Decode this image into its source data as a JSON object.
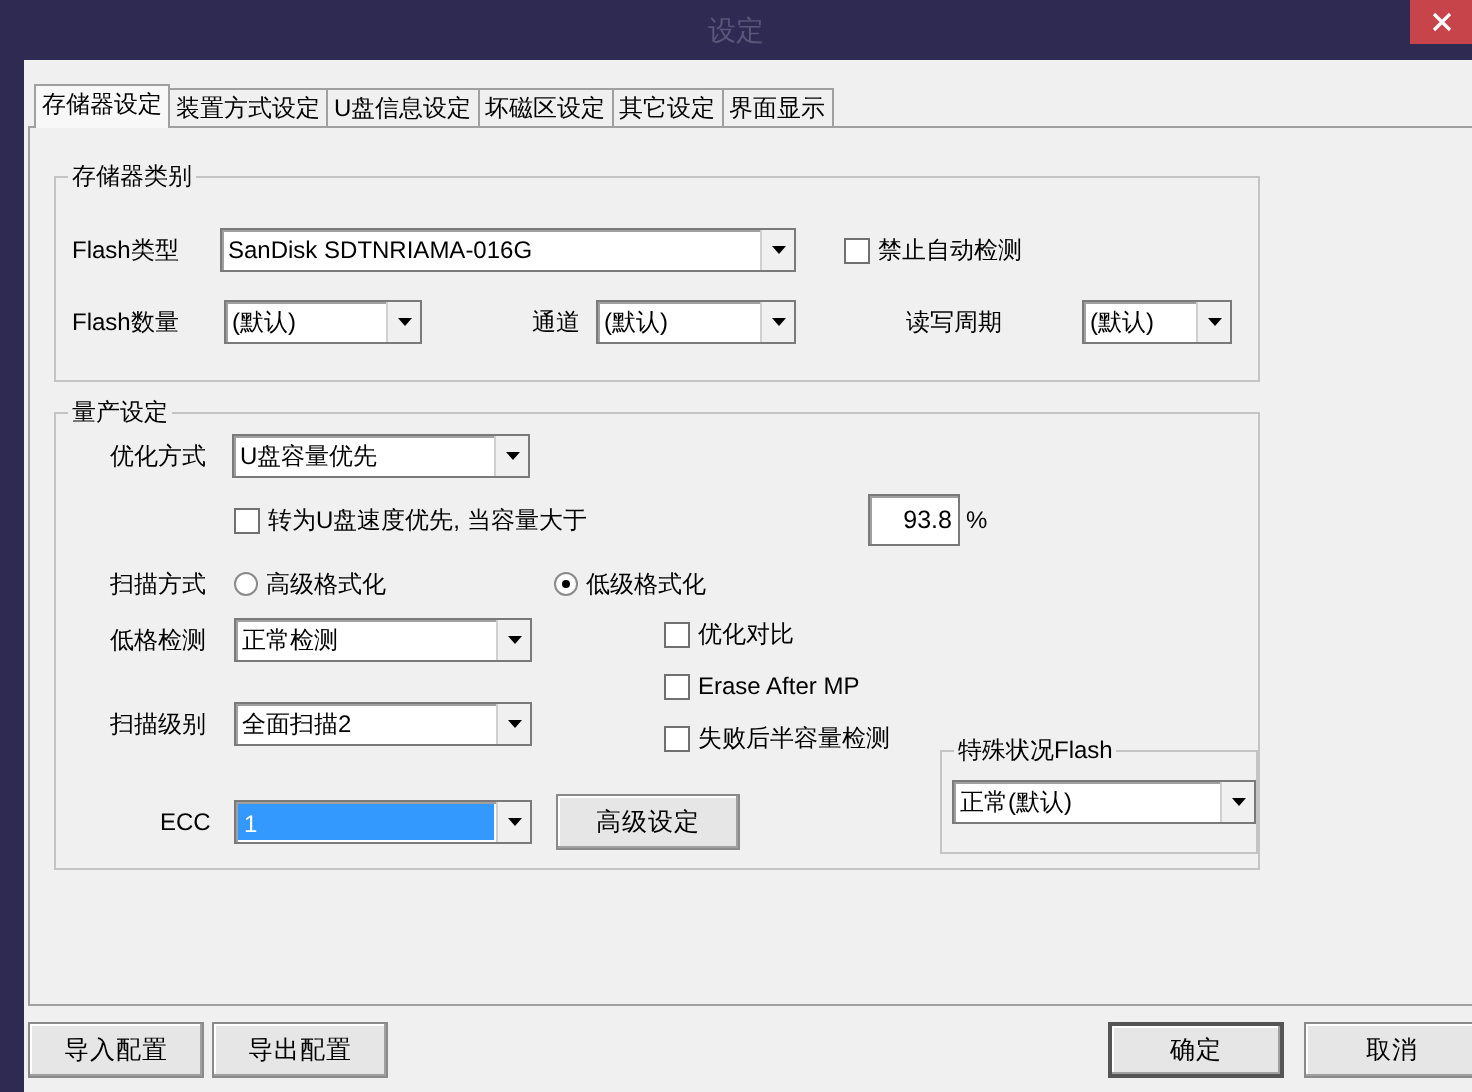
{
  "window": {
    "title": "设定"
  },
  "tabs": [
    {
      "label": "存储器设定",
      "selected": true
    },
    {
      "label": "装置方式设定",
      "selected": false
    },
    {
      "label": "U盘信息设定",
      "selected": false
    },
    {
      "label": "坏磁区设定",
      "selected": false
    },
    {
      "label": "其它设定",
      "selected": false
    },
    {
      "label": "界面显示",
      "selected": false
    }
  ],
  "storage_type": {
    "title": "存储器类别",
    "flash_type": {
      "label": "Flash类型",
      "value": "SanDisk SDTNRIAMA-016G"
    },
    "auto_detect_off": {
      "label": "禁止自动检测",
      "checked": false
    },
    "flash_count": {
      "label": "Flash数量",
      "value": "(默认)"
    },
    "channel": {
      "label": "通道",
      "value": "(默认)"
    },
    "rw_cycle": {
      "label": "读写周期",
      "value": "(默认)"
    }
  },
  "production": {
    "title": "量产设定",
    "optimize": {
      "label": "优化方式",
      "value": "U盘容量优先"
    },
    "speed_switch": {
      "label": "转为U盘速度优先, 当容量大于",
      "checked": false,
      "value": "93.8",
      "unit": "%"
    },
    "scan_mode": {
      "label": "扫描方式",
      "options": [
        {
          "label": "高级格式化",
          "selected": false
        },
        {
          "label": "低级格式化",
          "selected": true
        }
      ]
    },
    "low_format_check": {
      "label": "低格检测",
      "value": "正常检测"
    },
    "scan_level": {
      "label": "扫描级别",
      "value": "全面扫描2"
    },
    "options": [
      {
        "label": "优化对比",
        "checked": false
      },
      {
        "label": "Erase After MP",
        "checked": false
      },
      {
        "label": "失败后半容量检测",
        "checked": false
      }
    ],
    "ecc": {
      "label": "ECC",
      "value": "1",
      "selected": true
    },
    "advanced_button": "高级设定",
    "special_flash": {
      "title": "特殊状况Flash",
      "value": "正常(默认)"
    }
  },
  "footer_left": [
    {
      "label": "导入配置",
      "default": false
    },
    {
      "label": "导出配置",
      "default": false
    }
  ],
  "footer_right": [
    {
      "label": "确定",
      "default": true
    },
    {
      "label": "取消",
      "default": false
    }
  ]
}
